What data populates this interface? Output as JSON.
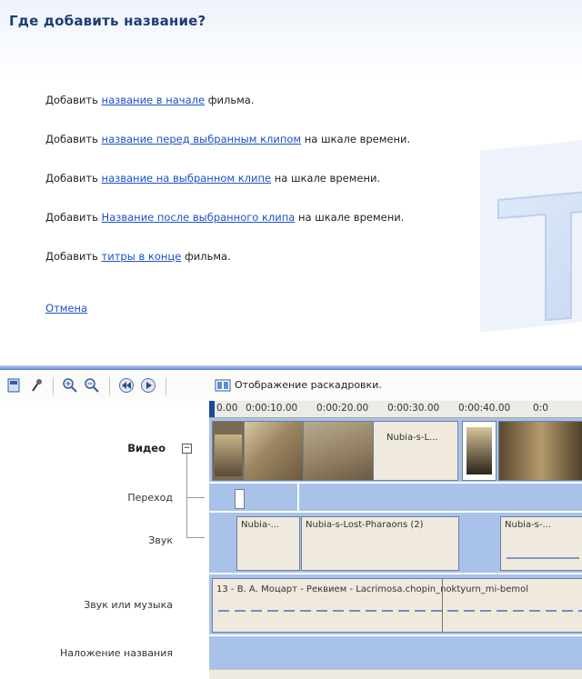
{
  "task_pane": {
    "title": "Где добавить название?",
    "tasks": [
      {
        "prefix": "Добавить ",
        "link": "название в начале",
        "suffix": " фильма."
      },
      {
        "prefix": "Добавить ",
        "link": "название перед выбранным клипом",
        "suffix": " на шкале времени."
      },
      {
        "prefix": "Добавить ",
        "link": "название на выбранном клипе",
        "suffix": " на шкале времени."
      },
      {
        "prefix": "Добавить ",
        "link": "Название после выбранного клипа",
        "suffix": " на шкале времени."
      },
      {
        "prefix": "Добавить ",
        "link": "титры в конце",
        "suffix": " фильма."
      }
    ],
    "cancel": "Отмена"
  },
  "toolbar": {
    "icons": [
      "storyboard-view-icon",
      "narrate-icon",
      "zoom-in-icon",
      "zoom-out-icon",
      "rewind-icon",
      "play-icon"
    ],
    "storyboard_label": "Отображение раскадровки."
  },
  "timeline": {
    "ruler_ticks": [
      "0.00",
      "0:00:10.00",
      "0:00:20.00",
      "0:00:30.00",
      "0:00:40.00",
      "0:0"
    ],
    "tracks": {
      "video": "Видео",
      "transition": "Переход",
      "audio": "Звук",
      "audio_music": "Звук или музыка",
      "title_overlay": "Наложение названия"
    },
    "video_clips": [
      "Nubia-s-L..."
    ],
    "audio_clips": [
      "Nubia-...",
      "Nubia-s-Lost-Pharaons (2)",
      "Nubia-s-..."
    ],
    "music_clip": "13 - В. А. Моцарт - Реквием - Lacrimosa.chopin_noktyurn_mi-bemol"
  },
  "colors": {
    "title": "#1c3d78",
    "link": "#1b52c6",
    "track": "#a9c2ea"
  }
}
